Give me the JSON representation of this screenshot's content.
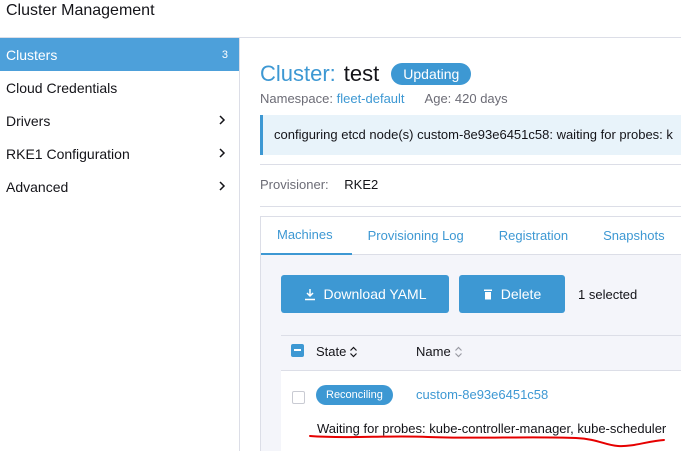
{
  "header": {
    "title": "Cluster Management"
  },
  "sidebar": {
    "items": [
      {
        "label": "Clusters",
        "count": "3"
      },
      {
        "label": "Cloud Credentials"
      },
      {
        "label": "Drivers"
      },
      {
        "label": "RKE1 Configuration"
      },
      {
        "label": "Advanced"
      }
    ]
  },
  "cluster": {
    "kind_label": "Cluster:",
    "name": "test",
    "status": "Updating",
    "namespace_label": "Namespace:",
    "namespace": "fleet-default",
    "age": "Age: 420 days",
    "banner": "configuring etcd node(s) custom-8e93e6451c58: waiting for probes: k",
    "provisioner_label": "Provisioner:",
    "provisioner": "RKE2"
  },
  "tabs": [
    "Machines",
    "Provisioning Log",
    "Registration",
    "Snapshots"
  ],
  "machines": {
    "download_label": "Download YAML",
    "delete_label": "Delete",
    "selected": "1 selected",
    "columns": [
      "State",
      "Name"
    ],
    "rows": [
      {
        "state": "Reconciling",
        "name": "custom-8e93e6451c58",
        "message": "Waiting for probes: kube-controller-manager, kube-scheduler"
      }
    ]
  },
  "colors": {
    "accent": "#3d98d3",
    "active_nav": "#4da0da",
    "annotation": "#e60000"
  }
}
